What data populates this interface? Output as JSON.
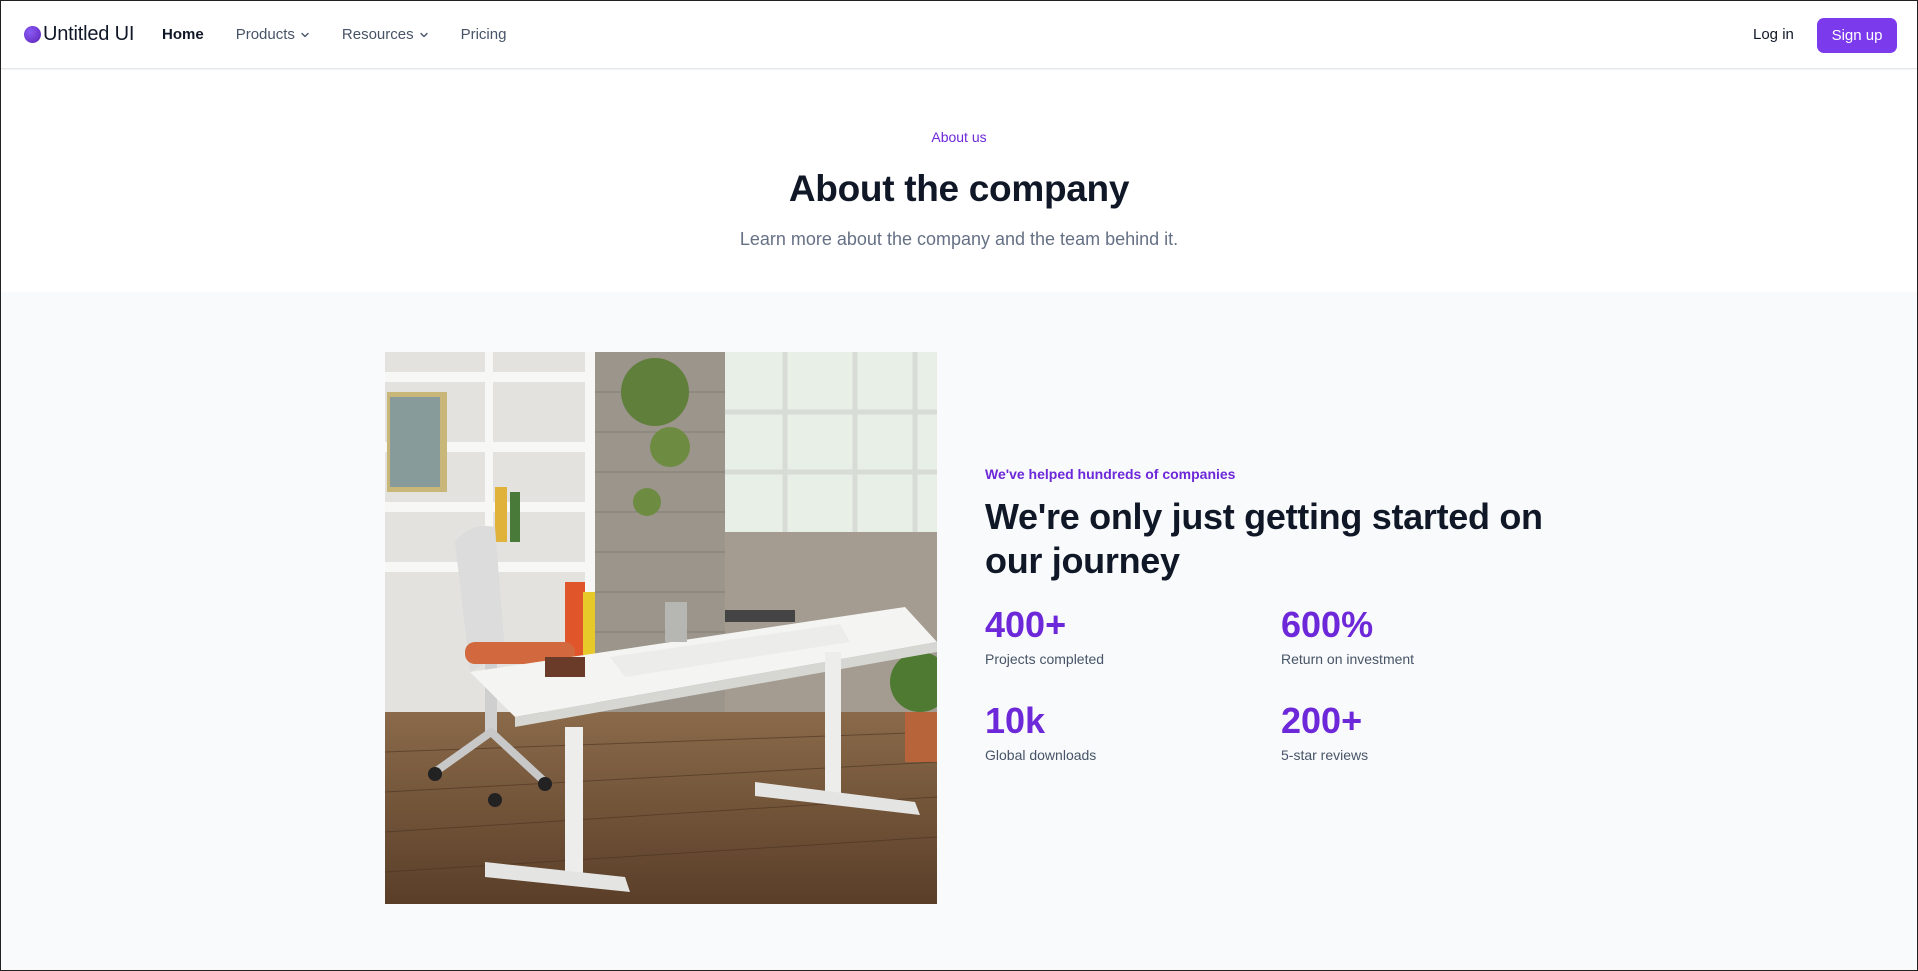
{
  "nav": {
    "logo_text": "Untitled UI",
    "links": [
      {
        "label": "Home",
        "active": true,
        "dropdown": false
      },
      {
        "label": "Products",
        "active": false,
        "dropdown": true
      },
      {
        "label": "Resources",
        "active": false,
        "dropdown": true
      },
      {
        "label": "Pricing",
        "active": false,
        "dropdown": false
      }
    ],
    "login_label": "Log in",
    "signup_label": "Sign up"
  },
  "hero": {
    "eyebrow": "About us",
    "title": "About the company",
    "subtitle": "Learn more about the company and the team behind it."
  },
  "about": {
    "image_icon": "office-photo",
    "kicker": "We've helped hundreds of companies",
    "title": "We're only just getting started on our journey",
    "stats": [
      {
        "value": "400+",
        "label": "Projects completed"
      },
      {
        "value": "600%",
        "label": "Return on investment"
      },
      {
        "value": "10k",
        "label": "Global downloads"
      },
      {
        "value": "200+",
        "label": "5-star reviews"
      }
    ]
  },
  "colors": {
    "accent": "#7c3aed",
    "accent_text": "#6d28d9",
    "heading": "#101828",
    "muted": "#667085",
    "section_bg": "#f9fafb"
  }
}
